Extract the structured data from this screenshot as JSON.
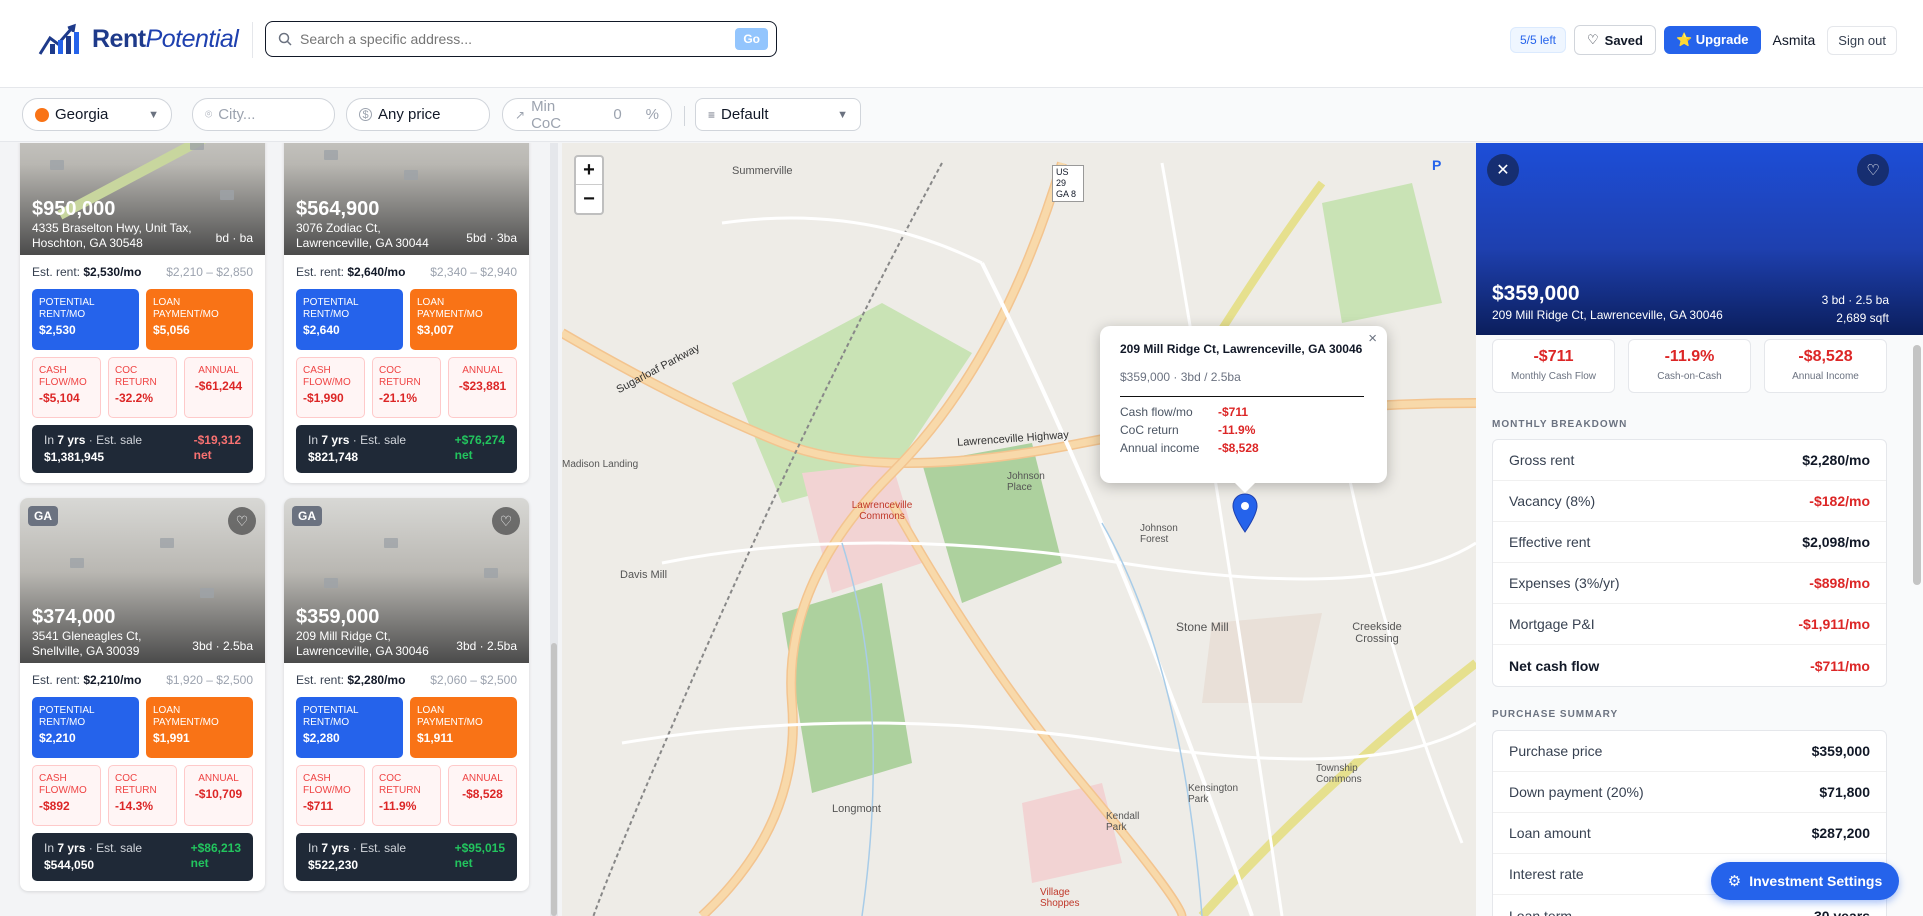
{
  "brand": {
    "name_bold": "Rent",
    "name_italic": "Potential"
  },
  "search": {
    "placeholder": "Search a specific address...",
    "go": "Go"
  },
  "header": {
    "searches_left": "5/5 left",
    "saved": "Saved",
    "upgrade": "⭐ Upgrade",
    "user": "Asmita",
    "signout": "Sign out"
  },
  "filters": {
    "state": "Georgia",
    "city_placeholder": "City...",
    "price": "Any price",
    "min_coc_label": "Min CoC",
    "min_coc_value": "0",
    "min_coc_unit": "%",
    "sort": "Default"
  },
  "cards": [
    {
      "state": "",
      "price": "$950,000",
      "addr1": "4335 Braselton Hwy, Unit Tax,",
      "addr2": "Hoschton, GA 30548",
      "beds": "bd · ba",
      "rent": "$2,530/mo",
      "range": "$2,210 – $2,850",
      "potential": "$2,530",
      "loan": "$5,056",
      "cash_flow": "-$5,104",
      "coc": "-32.2%",
      "annual": "-$61,244",
      "years": "7 yrs",
      "sale": "$1,381,945",
      "net": "-$19,312",
      "net_label": "net",
      "net_sign": "neg"
    },
    {
      "state": "",
      "price": "$564,900",
      "addr1": "3076 Zodiac Ct,",
      "addr2": "Lawrenceville, GA 30044",
      "beds": "5bd · 3ba",
      "rent": "$2,640/mo",
      "range": "$2,340 – $2,940",
      "potential": "$2,640",
      "loan": "$3,007",
      "cash_flow": "-$1,990",
      "coc": "-21.1%",
      "annual": "-$23,881",
      "years": "7 yrs",
      "sale": "$821,748",
      "net": "+$76,274",
      "net_label": "net",
      "net_sign": "pos"
    },
    {
      "state": "GA",
      "price": "$374,000",
      "addr1": "3541 Gleneagles Ct,",
      "addr2": "Snellville, GA 30039",
      "beds": "3bd · 2.5ba",
      "rent": "$2,210/mo",
      "range": "$1,920 – $2,500",
      "potential": "$2,210",
      "loan": "$1,991",
      "cash_flow": "-$892",
      "coc": "-14.3%",
      "annual": "-$10,709",
      "years": "7 yrs",
      "sale": "$544,050",
      "net": "+$86,213",
      "net_label": "net",
      "net_sign": "pos"
    },
    {
      "state": "GA",
      "price": "$359,000",
      "addr1": "209 Mill Ridge Ct,",
      "addr2": "Lawrenceville, GA 30046",
      "beds": "3bd · 2.5ba",
      "rent": "$2,280/mo",
      "range": "$2,060 – $2,500",
      "potential": "$2,280",
      "loan": "$1,911",
      "cash_flow": "-$711",
      "coc": "-11.9%",
      "annual": "-$8,528",
      "years": "7 yrs",
      "sale": "$522,230",
      "net": "+$95,015",
      "net_label": "net",
      "net_sign": "pos"
    }
  ],
  "card_labels": {
    "est_rent": "Est. rent:",
    "potential": "POTENTIAL RENT/MO",
    "loan": "LOAN PAYMENT/MO",
    "cash_flow": "CASH FLOW/MO",
    "coc": "COC RETURN",
    "annual": "ANNUAL",
    "in": "In",
    "est_sale": "· Est. sale"
  },
  "map": {
    "labels": [
      "Summerville",
      "Lawrenceville Highway",
      "Sugarloaf Parkway",
      "Lawrenceville Commons",
      "Davis Mill",
      "Stone Mill",
      "Creekside Crossing",
      "Longmont",
      "Johnson Place",
      "Johnson Forest",
      "Madison Landing",
      "Township Commons",
      "Kensington Park",
      "Kendall Park",
      "Village Shoppes",
      "US 29 GA 8"
    ],
    "popup": {
      "title": "209 Mill Ridge Ct, Lawrenceville, GA 30046",
      "subtitle": "$359,000 · 3bd / 2.5ba",
      "cash_flow_label": "Cash flow/mo",
      "cash_flow": "-$711",
      "coc_label": "CoC return",
      "coc": "-11.9%",
      "annual_label": "Annual income",
      "annual": "-$8,528"
    }
  },
  "detail": {
    "price": "$359,000",
    "address": "209 Mill Ridge Ct, Lawrenceville, GA 30046",
    "beds": "3 bd · 2.5 ba",
    "sqft": "2,689 sqft",
    "metrics": [
      {
        "value": "-$711",
        "label": "Monthly Cash Flow"
      },
      {
        "value": "-11.9%",
        "label": "Cash-on-Cash"
      },
      {
        "value": "-$8,528",
        "label": "Annual Income"
      }
    ],
    "monthly_title": "MONTHLY BREAKDOWN",
    "monthly": [
      {
        "label": "Gross rent",
        "value": "$2,280/mo",
        "neg": false
      },
      {
        "label": "Vacancy (8%)",
        "value": "-$182/mo",
        "neg": true
      },
      {
        "label": "Effective rent",
        "value": "$2,098/mo",
        "neg": false
      },
      {
        "label": "Expenses (3%/yr)",
        "value": "-$898/mo",
        "neg": true
      },
      {
        "label": "Mortgage P&I",
        "value": "-$1,911/mo",
        "neg": true
      },
      {
        "label": "Net cash flow",
        "value": "-$711/mo",
        "neg": true
      }
    ],
    "purchase_title": "PURCHASE SUMMARY",
    "purchase": [
      {
        "label": "Purchase price",
        "value": "$359,000"
      },
      {
        "label": "Down payment (20%)",
        "value": "$71,800"
      },
      {
        "label": "Loan amount",
        "value": "$287,200"
      },
      {
        "label": "Interest rate",
        "value": ""
      },
      {
        "label": "Loan term",
        "value": "30 years"
      }
    ],
    "investment_settings": "Investment Settings"
  }
}
